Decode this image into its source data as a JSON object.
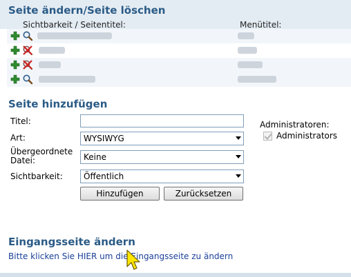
{
  "sections": {
    "change_delete": {
      "title": "Seite ändern/Seite löschen",
      "col_visibility": "Sichtbarkeit / Seitentitel:",
      "col_menu": "Menütitel:",
      "rows": [
        {
          "view_icon": "magnifier-icon"
        },
        {
          "view_icon": "hidden-page-icon"
        },
        {
          "view_icon": "hidden-page-icon"
        },
        {
          "view_icon": "magnifier-icon"
        }
      ]
    },
    "add_page": {
      "title": "Seite hinzufügen",
      "title_label": "Titel:",
      "title_value": "",
      "type_label": "Art:",
      "type_value": "WYSIWYG",
      "parent_label_line1": "Übergeordnete",
      "parent_label_line2": "Datei:",
      "parent_value": "Keine",
      "visibility_label": "Sichtbarkeit:",
      "visibility_value": "Öffentlich",
      "admins_label": "Administratoren:",
      "admins_option": "Administrators",
      "admins_checked": true,
      "add_button": "Hinzufügen",
      "reset_button": "Zurücksetzen"
    },
    "start_page": {
      "title": "Eingangsseite ändern",
      "link_text": "Bitte klicken Sie HIER um die Eingangsseite zu ändern"
    }
  },
  "colors": {
    "heading": "#2b5b86",
    "band": "#e4ecf3",
    "link": "#1a3f99",
    "add_icon": "#2e8b2e",
    "hidden_icon": "#cc2222"
  }
}
